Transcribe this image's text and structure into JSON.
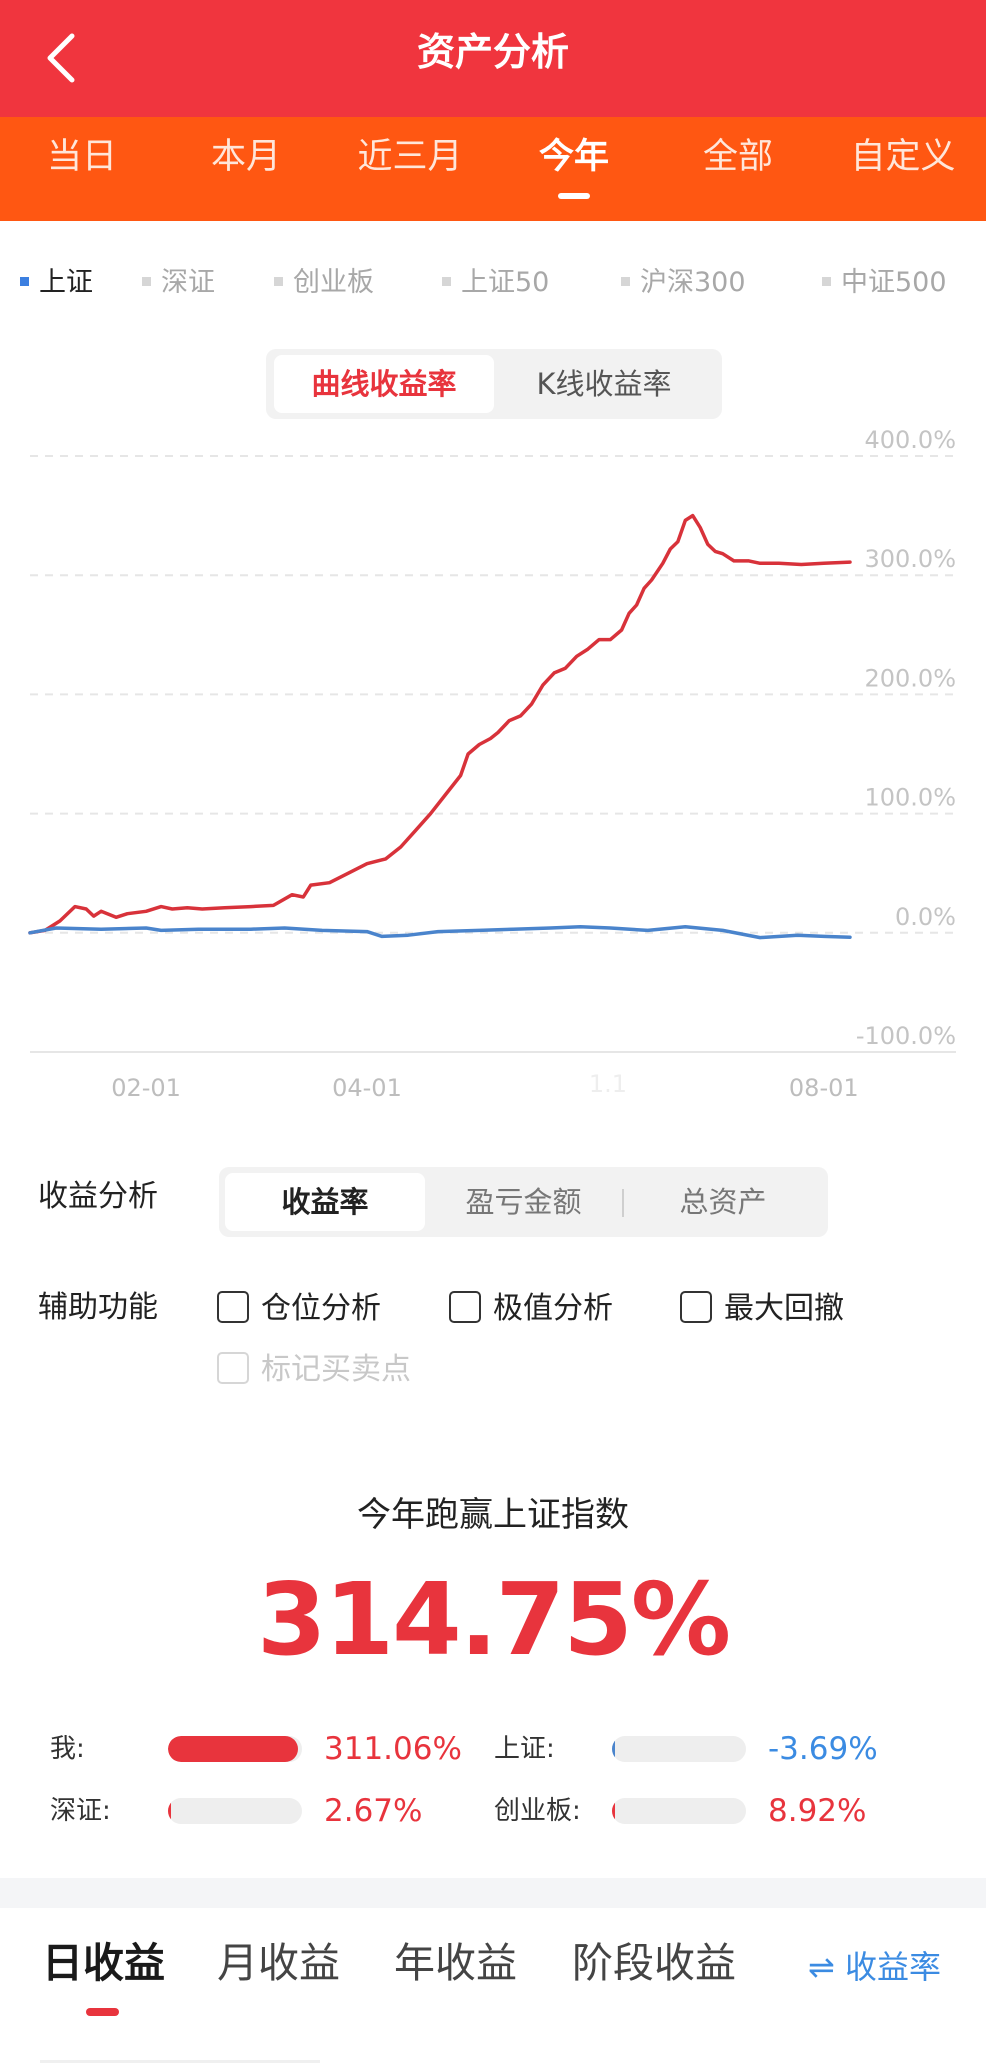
{
  "header": {
    "title": "资产分析"
  },
  "period_tabs": [
    "当日",
    "本月",
    "近三月",
    "今年",
    "全部",
    "自定义"
  ],
  "period_tabs_active": "今年",
  "index_legend": [
    "上证",
    "深证",
    "创业板",
    "上证50",
    "沪深300",
    "中证500"
  ],
  "index_legend_active": "上证",
  "curve_toggle": {
    "options": [
      "曲线收益率",
      "K线收益率"
    ],
    "active": "曲线收益率"
  },
  "colors": {
    "header_red": "#f0353e",
    "tab_orange": "#ff5712",
    "accent_red": "#e8343d",
    "index_blue": "#4a84cc",
    "link_blue": "#3b8be2"
  },
  "chart_data": {
    "type": "line",
    "x_range": [
      "2023-01-01",
      "2023-08-08"
    ],
    "x_ticks": [
      {
        "label": "02-01",
        "date": "2023-02-01"
      },
      {
        "label": "04-01",
        "date": "2023-04-01"
      },
      {
        "label": "08-01",
        "date": "2023-08-01"
      }
    ],
    "ylim": [
      -100,
      400
    ],
    "y_ticks": [
      {
        "value": 400,
        "label": "400.0%"
      },
      {
        "value": 300,
        "label": "300.0%"
      },
      {
        "value": 200,
        "label": "200.0%"
      },
      {
        "value": 100,
        "label": "100.0%"
      },
      {
        "value": 0,
        "label": "0.0%"
      },
      {
        "value": -100,
        "label": "-100.0%"
      }
    ],
    "y_axis_position": "right",
    "grid": "dashed horizontal",
    "series": [
      {
        "name": "我",
        "color": "#d8323a",
        "points": [
          [
            "2023-01-01",
            0
          ],
          [
            "2023-01-05",
            2
          ],
          [
            "2023-01-09",
            10
          ],
          [
            "2023-01-13",
            22
          ],
          [
            "2023-01-16",
            20
          ],
          [
            "2023-01-18",
            14
          ],
          [
            "2023-01-20",
            18
          ],
          [
            "2023-01-24",
            13
          ],
          [
            "2023-01-27",
            16
          ],
          [
            "2023-02-01",
            18
          ],
          [
            "2023-02-05",
            22
          ],
          [
            "2023-02-08",
            20
          ],
          [
            "2023-02-12",
            21
          ],
          [
            "2023-02-16",
            20
          ],
          [
            "2023-02-22",
            21
          ],
          [
            "2023-03-01",
            22
          ],
          [
            "2023-03-07",
            23
          ],
          [
            "2023-03-12",
            32
          ],
          [
            "2023-03-15",
            30
          ],
          [
            "2023-03-17",
            40
          ],
          [
            "2023-03-22",
            42
          ],
          [
            "2023-03-27",
            50
          ],
          [
            "2023-04-01",
            58
          ],
          [
            "2023-04-06",
            62
          ],
          [
            "2023-04-10",
            72
          ],
          [
            "2023-04-14",
            86
          ],
          [
            "2023-04-18",
            100
          ],
          [
            "2023-04-22",
            116
          ],
          [
            "2023-04-26",
            132
          ],
          [
            "2023-04-28",
            150
          ],
          [
            "2023-05-01",
            158
          ],
          [
            "2023-05-04",
            163
          ],
          [
            "2023-05-06",
            168
          ],
          [
            "2023-05-09",
            178
          ],
          [
            "2023-05-12",
            182
          ],
          [
            "2023-05-15",
            192
          ],
          [
            "2023-05-18",
            208
          ],
          [
            "2023-05-21",
            218
          ],
          [
            "2023-05-24",
            222
          ],
          [
            "2023-05-27",
            232
          ],
          [
            "2023-05-30",
            238
          ],
          [
            "2023-06-02",
            246
          ],
          [
            "2023-06-05",
            246
          ],
          [
            "2023-06-08",
            254
          ],
          [
            "2023-06-10",
            268
          ],
          [
            "2023-06-12",
            275
          ],
          [
            "2023-06-14",
            289
          ],
          [
            "2023-06-16",
            296
          ],
          [
            "2023-06-19",
            310
          ],
          [
            "2023-06-21",
            322
          ],
          [
            "2023-06-23",
            328
          ],
          [
            "2023-06-25",
            346
          ],
          [
            "2023-06-27",
            350
          ],
          [
            "2023-06-29",
            340
          ],
          [
            "2023-07-01",
            326
          ],
          [
            "2023-07-03",
            320
          ],
          [
            "2023-07-05",
            318
          ],
          [
            "2023-07-08",
            312
          ],
          [
            "2023-07-12",
            312
          ],
          [
            "2023-07-15",
            310
          ],
          [
            "2023-07-20",
            310
          ],
          [
            "2023-07-26",
            309
          ],
          [
            "2023-08-01",
            310
          ],
          [
            "2023-08-08",
            311
          ]
        ]
      },
      {
        "name": "上证",
        "color": "#4a84cc",
        "points": [
          [
            "2023-01-01",
            0
          ],
          [
            "2023-01-08",
            4
          ],
          [
            "2023-01-20",
            3
          ],
          [
            "2023-02-01",
            4
          ],
          [
            "2023-02-05",
            2
          ],
          [
            "2023-02-15",
            3
          ],
          [
            "2023-03-01",
            3
          ],
          [
            "2023-03-10",
            4
          ],
          [
            "2023-03-20",
            2
          ],
          [
            "2023-04-01",
            1
          ],
          [
            "2023-04-05",
            -3
          ],
          [
            "2023-04-12",
            -2
          ],
          [
            "2023-04-20",
            1
          ],
          [
            "2023-05-01",
            2
          ],
          [
            "2023-05-10",
            3
          ],
          [
            "2023-05-20",
            4
          ],
          [
            "2023-05-28",
            5
          ],
          [
            "2023-06-05",
            4
          ],
          [
            "2023-06-15",
            2
          ],
          [
            "2023-06-25",
            5
          ],
          [
            "2023-07-05",
            2
          ],
          [
            "2023-07-15",
            -4
          ],
          [
            "2023-07-25",
            -2
          ],
          [
            "2023-08-01",
            -3
          ],
          [
            "2023-08-08",
            -3.69
          ]
        ]
      }
    ],
    "hover_date_text": "1.1"
  },
  "analysis": {
    "label": "收益分析",
    "options": [
      "收益率",
      "盈亏金额",
      "总资产"
    ],
    "active": "收益率"
  },
  "aux": {
    "label": "辅助功能",
    "checks": [
      "仓位分析",
      "极值分析",
      "最大回撤",
      "标记买卖点"
    ],
    "disabled": "标记买卖点"
  },
  "summary": {
    "title": "今年跑赢上证指数",
    "value": "314.75%"
  },
  "comparison": [
    {
      "label": "我:",
      "value_text": "311.06%",
      "fill": 0.97,
      "color": "#e8343d",
      "value_color": "#e8343d"
    },
    {
      "label": "上证:",
      "value_text": "-3.69%",
      "fill": 0.0,
      "color": "#4a84cc",
      "value_color": "#3b8be2"
    },
    {
      "label": "深证:",
      "value_text": "2.67%",
      "fill": 0.0,
      "color": "#e8343d",
      "value_color": "#e8343d"
    },
    {
      "label": "创业板:",
      "value_text": "8.92%",
      "fill": 0.0,
      "color": "#e8343d",
      "value_color": "#e8343d"
    }
  ],
  "bottom_tabs": [
    "日收益",
    "月收益",
    "年收益",
    "阶段收益"
  ],
  "bottom_tabs_active": "日收益",
  "switch_link": "⇌ 收益率"
}
